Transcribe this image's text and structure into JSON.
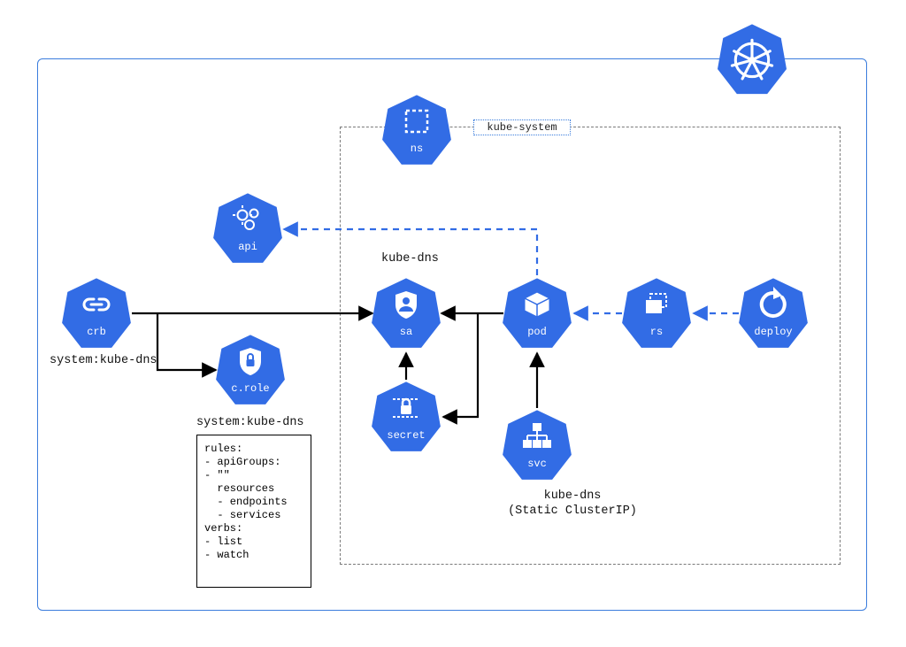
{
  "colors": {
    "accent": "#326CE5",
    "stroke_solid": "#000000",
    "stroke_dashed": "#326CE5"
  },
  "labels": {
    "namespace": "kube-system",
    "crb": "system:kube-dns",
    "kube_dns_header": "kube-dns",
    "svc_l1": "kube-dns",
    "svc_l2": "(Static ClusterIP)",
    "crole_header": "system:kube-dns"
  },
  "nodes": {
    "ns": {
      "label": "ns"
    },
    "api": {
      "label": "api"
    },
    "crb": {
      "label": "crb"
    },
    "crole": {
      "label": "c.role"
    },
    "sa": {
      "label": "sa"
    },
    "pod": {
      "label": "pod"
    },
    "rs": {
      "label": "rs"
    },
    "deploy": {
      "label": "deploy"
    },
    "secret": {
      "label": "secret"
    },
    "svc": {
      "label": "svc"
    }
  },
  "rules_box": "rules:\n- apiGroups:\n- \"\"\n  resources\n  - endpoints\n  - services\nverbs:\n- list\n- watch",
  "edges": [
    {
      "from": "crb",
      "to": "sa",
      "style": "solid",
      "via": "straight"
    },
    {
      "from": "crb",
      "to": "crole",
      "style": "solid",
      "via": "elbow"
    },
    {
      "from": "secret",
      "to": "sa",
      "style": "solid",
      "via": "straight"
    },
    {
      "from": "pod",
      "to": "sa",
      "style": "solid",
      "via": "straight"
    },
    {
      "from": "pod",
      "to": "secret",
      "style": "solid",
      "via": "elbow"
    },
    {
      "from": "svc",
      "to": "pod",
      "style": "solid",
      "via": "straight"
    },
    {
      "from": "pod",
      "to": "api",
      "style": "dashed",
      "via": "elbow"
    },
    {
      "from": "rs",
      "to": "pod",
      "style": "dashed",
      "via": "straight"
    },
    {
      "from": "deploy",
      "to": "rs",
      "style": "dashed",
      "via": "straight"
    }
  ]
}
